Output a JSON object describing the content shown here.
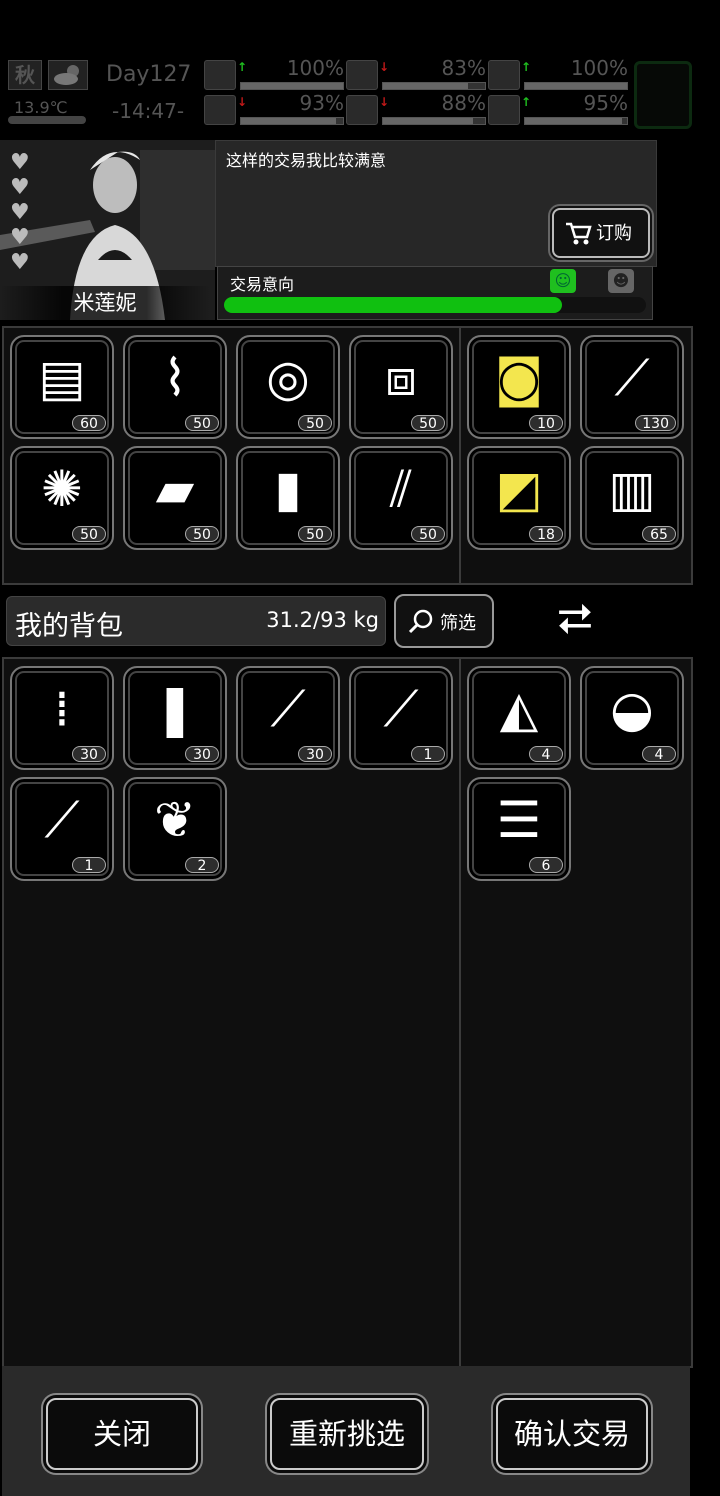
{
  "hud": {
    "season": "秋",
    "temperature": "13.9℃",
    "day": "Day127",
    "time": "-14:47-",
    "stats": [
      {
        "icon": "first-aid-icon",
        "trend": "up",
        "value": "100%",
        "level": 1.0
      },
      {
        "icon": "stomach-icon",
        "trend": "down",
        "value": "83%",
        "level": 0.83
      },
      {
        "icon": "pill-icon",
        "trend": "up",
        "value": "100%",
        "level": 1.0
      },
      {
        "icon": "leg-icon",
        "trend": "down",
        "value": "93%",
        "level": 0.93
      },
      {
        "icon": "water-drop-icon",
        "trend": "down",
        "value": "88%",
        "level": 0.88
      },
      {
        "icon": "heart-icon",
        "trend": "up",
        "value": "95%",
        "level": 0.95
      }
    ]
  },
  "npc": {
    "name": "米莲妮",
    "hearts": 5,
    "speech": "这样的交易我比较满意",
    "order_label": "订购",
    "intent_label": "交易意向",
    "intent_level": 0.8
  },
  "trader_items_left": [
    {
      "icon": "cloth-icon",
      "count": "60"
    },
    {
      "icon": "scrap-metal-icon",
      "count": "50"
    },
    {
      "icon": "log-icon",
      "count": "50"
    },
    {
      "icon": "plastic-bottle-icon",
      "count": "50"
    },
    {
      "icon": "cotton-icon",
      "count": "50"
    },
    {
      "icon": "whetstone-icon",
      "count": "50"
    },
    {
      "icon": "battery-icon",
      "count": "50"
    },
    {
      "icon": "screw-icon",
      "count": "50"
    }
  ],
  "trader_items_right": [
    {
      "icon": "spool-icon",
      "count": "10",
      "selected": true
    },
    {
      "icon": "glue-icon",
      "count": "130",
      "selected": false
    },
    {
      "icon": "fabric-icon",
      "count": "18",
      "selected": true
    },
    {
      "icon": "fuel-barrel-icon",
      "count": "65",
      "selected": false
    }
  ],
  "backpack": {
    "title": "我的背包",
    "weight": "31.2/93 kg",
    "filter_label": "筛选"
  },
  "my_items_left": [
    {
      "icon": "rifle-ammo-icon",
      "count": "30"
    },
    {
      "icon": "pistol-ammo-icon",
      "count": "30"
    },
    {
      "icon": "sniper-ammo-icon",
      "count": "30"
    },
    {
      "icon": "shovel-icon",
      "count": "1"
    },
    {
      "icon": "axe-icon",
      "count": "1"
    },
    {
      "icon": "horn-icon",
      "count": "2"
    }
  ],
  "my_items_right": [
    {
      "icon": "pizza-icon",
      "count": "4"
    },
    {
      "icon": "salad-bowl-icon",
      "count": "4"
    },
    {
      "icon": "sandwich-icon",
      "count": "6"
    }
  ],
  "footer": {
    "close": "关闭",
    "reselect": "重新挑选",
    "confirm": "确认交易"
  },
  "colors": {
    "intent_fill": "#10c010",
    "selected_item": "#f3e64e",
    "trend_up": "#1fbf1f",
    "trend_down": "#c01818"
  }
}
